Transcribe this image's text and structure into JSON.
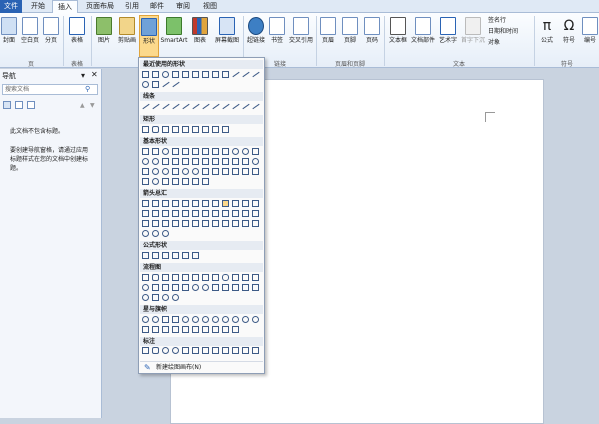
{
  "tabs": [
    "文件",
    "开始",
    "插入",
    "页面布局",
    "引用",
    "邮件",
    "审阅",
    "视图"
  ],
  "ribbon": {
    "buttons": [
      "封面",
      "空白页",
      "分页",
      "表格",
      "图片",
      "剪贴画",
      "形状",
      "SmartArt",
      "图表",
      "屏幕截图",
      "超链接",
      "书签",
      "交叉引用",
      "页眉",
      "页脚",
      "页码",
      "文本框",
      "文档部件",
      "艺术字",
      "首字下沉",
      "公式",
      "符号",
      "编号"
    ],
    "side_items": [
      "签名行",
      "日期和时间",
      "对象"
    ],
    "groups": [
      "页",
      "表格",
      "链接",
      "页眉和页脚",
      "文本",
      "符号"
    ]
  },
  "nav": {
    "title": "导航",
    "search_placeholder": "搜索文档",
    "empty": "此文档不包含标题。",
    "hint": "要创建导航窗格，请通过应用标题样式在您的文档中创建标题。"
  },
  "shapes_menu": {
    "sections": [
      "最近使用的形状",
      "线条",
      "矩形",
      "基本形状",
      "箭头总汇",
      "公式形状",
      "流程图",
      "星与旗帜",
      "标注"
    ],
    "new_canvas": "新建绘图画布(N)"
  },
  "colors": {
    "accent": "#2a63b4",
    "ribbon": "#e6eef8"
  }
}
